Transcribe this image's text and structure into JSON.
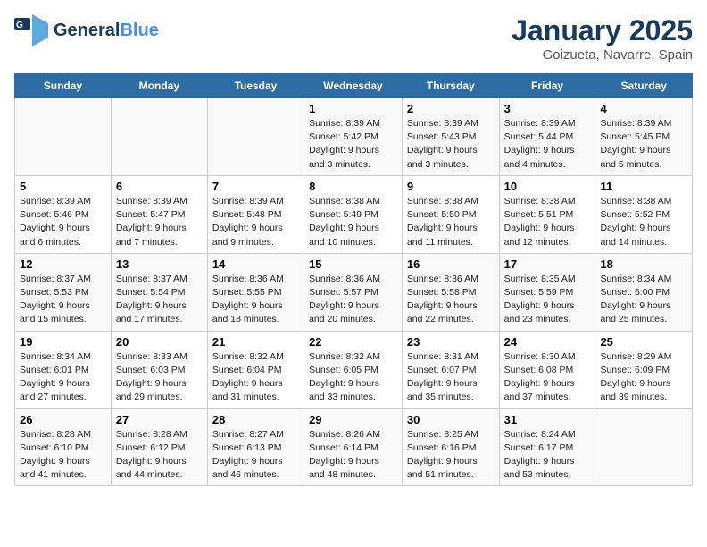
{
  "header": {
    "logo_general": "General",
    "logo_blue": "Blue",
    "title": "January 2025",
    "subtitle": "Goizueta, Navarre, Spain"
  },
  "weekdays": [
    "Sunday",
    "Monday",
    "Tuesday",
    "Wednesday",
    "Thursday",
    "Friday",
    "Saturday"
  ],
  "weeks": [
    [
      {
        "day": "",
        "info": ""
      },
      {
        "day": "",
        "info": ""
      },
      {
        "day": "",
        "info": ""
      },
      {
        "day": "1",
        "info": "Sunrise: 8:39 AM\nSunset: 5:42 PM\nDaylight: 9 hours and 3 minutes."
      },
      {
        "day": "2",
        "info": "Sunrise: 8:39 AM\nSunset: 5:43 PM\nDaylight: 9 hours and 3 minutes."
      },
      {
        "day": "3",
        "info": "Sunrise: 8:39 AM\nSunset: 5:44 PM\nDaylight: 9 hours and 4 minutes."
      },
      {
        "day": "4",
        "info": "Sunrise: 8:39 AM\nSunset: 5:45 PM\nDaylight: 9 hours and 5 minutes."
      }
    ],
    [
      {
        "day": "5",
        "info": "Sunrise: 8:39 AM\nSunset: 5:46 PM\nDaylight: 9 hours and 6 minutes."
      },
      {
        "day": "6",
        "info": "Sunrise: 8:39 AM\nSunset: 5:47 PM\nDaylight: 9 hours and 7 minutes."
      },
      {
        "day": "7",
        "info": "Sunrise: 8:39 AM\nSunset: 5:48 PM\nDaylight: 9 hours and 9 minutes."
      },
      {
        "day": "8",
        "info": "Sunrise: 8:38 AM\nSunset: 5:49 PM\nDaylight: 9 hours and 10 minutes."
      },
      {
        "day": "9",
        "info": "Sunrise: 8:38 AM\nSunset: 5:50 PM\nDaylight: 9 hours and 11 minutes."
      },
      {
        "day": "10",
        "info": "Sunrise: 8:38 AM\nSunset: 5:51 PM\nDaylight: 9 hours and 12 minutes."
      },
      {
        "day": "11",
        "info": "Sunrise: 8:38 AM\nSunset: 5:52 PM\nDaylight: 9 hours and 14 minutes."
      }
    ],
    [
      {
        "day": "12",
        "info": "Sunrise: 8:37 AM\nSunset: 5:53 PM\nDaylight: 9 hours and 15 minutes."
      },
      {
        "day": "13",
        "info": "Sunrise: 8:37 AM\nSunset: 5:54 PM\nDaylight: 9 hours and 17 minutes."
      },
      {
        "day": "14",
        "info": "Sunrise: 8:36 AM\nSunset: 5:55 PM\nDaylight: 9 hours and 18 minutes."
      },
      {
        "day": "15",
        "info": "Sunrise: 8:36 AM\nSunset: 5:57 PM\nDaylight: 9 hours and 20 minutes."
      },
      {
        "day": "16",
        "info": "Sunrise: 8:36 AM\nSunset: 5:58 PM\nDaylight: 9 hours and 22 minutes."
      },
      {
        "day": "17",
        "info": "Sunrise: 8:35 AM\nSunset: 5:59 PM\nDaylight: 9 hours and 23 minutes."
      },
      {
        "day": "18",
        "info": "Sunrise: 8:34 AM\nSunset: 6:00 PM\nDaylight: 9 hours and 25 minutes."
      }
    ],
    [
      {
        "day": "19",
        "info": "Sunrise: 8:34 AM\nSunset: 6:01 PM\nDaylight: 9 hours and 27 minutes."
      },
      {
        "day": "20",
        "info": "Sunrise: 8:33 AM\nSunset: 6:03 PM\nDaylight: 9 hours and 29 minutes."
      },
      {
        "day": "21",
        "info": "Sunrise: 8:32 AM\nSunset: 6:04 PM\nDaylight: 9 hours and 31 minutes."
      },
      {
        "day": "22",
        "info": "Sunrise: 8:32 AM\nSunset: 6:05 PM\nDaylight: 9 hours and 33 minutes."
      },
      {
        "day": "23",
        "info": "Sunrise: 8:31 AM\nSunset: 6:07 PM\nDaylight: 9 hours and 35 minutes."
      },
      {
        "day": "24",
        "info": "Sunrise: 8:30 AM\nSunset: 6:08 PM\nDaylight: 9 hours and 37 minutes."
      },
      {
        "day": "25",
        "info": "Sunrise: 8:29 AM\nSunset: 6:09 PM\nDaylight: 9 hours and 39 minutes."
      }
    ],
    [
      {
        "day": "26",
        "info": "Sunrise: 8:28 AM\nSunset: 6:10 PM\nDaylight: 9 hours and 41 minutes."
      },
      {
        "day": "27",
        "info": "Sunrise: 8:28 AM\nSunset: 6:12 PM\nDaylight: 9 hours and 44 minutes."
      },
      {
        "day": "28",
        "info": "Sunrise: 8:27 AM\nSunset: 6:13 PM\nDaylight: 9 hours and 46 minutes."
      },
      {
        "day": "29",
        "info": "Sunrise: 8:26 AM\nSunset: 6:14 PM\nDaylight: 9 hours and 48 minutes."
      },
      {
        "day": "30",
        "info": "Sunrise: 8:25 AM\nSunset: 6:16 PM\nDaylight: 9 hours and 51 minutes."
      },
      {
        "day": "31",
        "info": "Sunrise: 8:24 AM\nSunset: 6:17 PM\nDaylight: 9 hours and 53 minutes."
      },
      {
        "day": "",
        "info": ""
      }
    ]
  ]
}
